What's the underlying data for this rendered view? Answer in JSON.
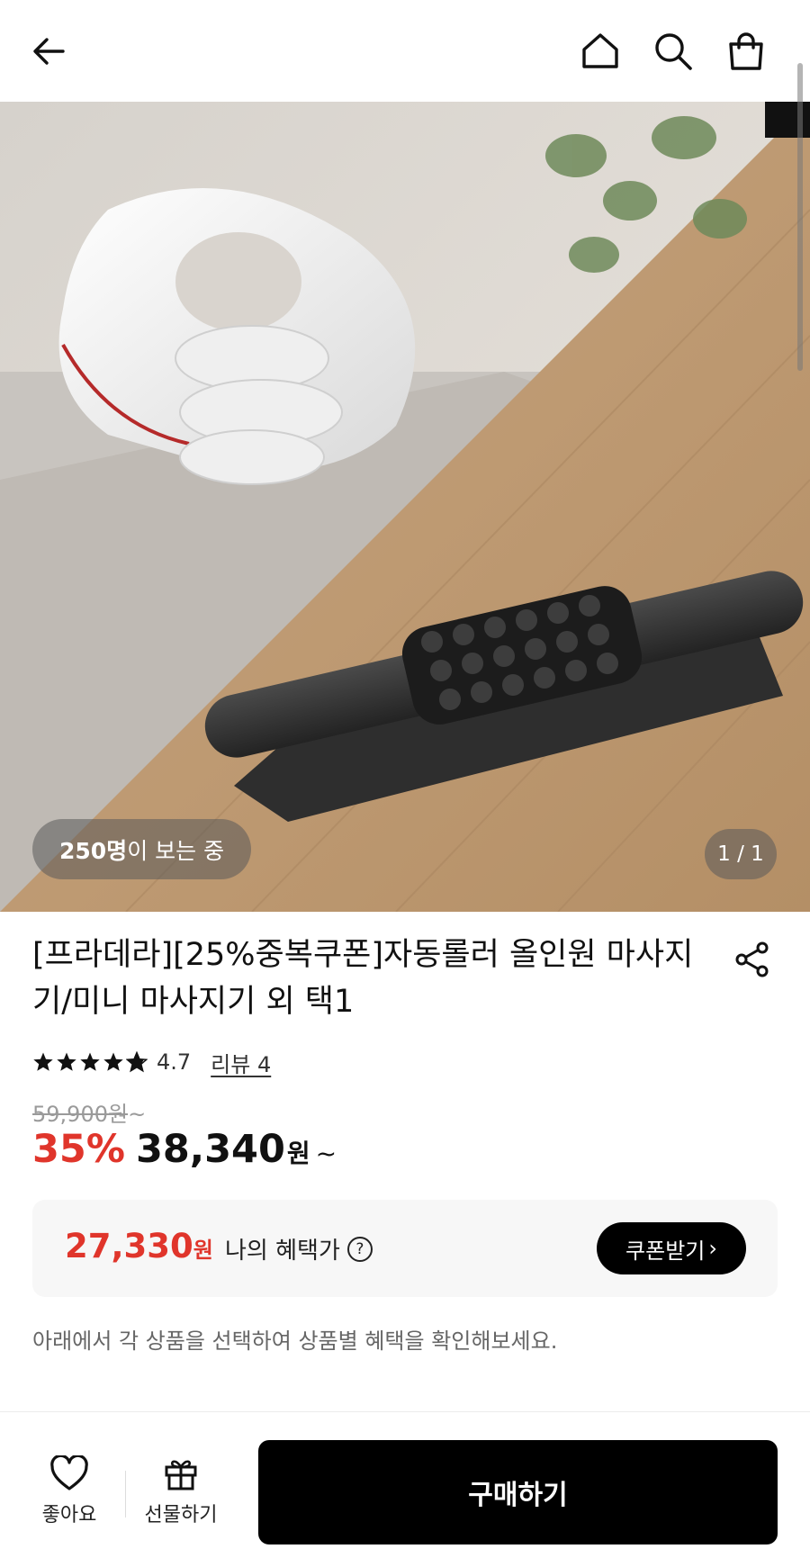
{
  "header": {
    "back_icon": "arrow-left-icon",
    "home_icon": "home-icon",
    "search_icon": "search-icon",
    "cart_icon": "shopping-bag-icon"
  },
  "hero": {
    "viewers_count": "250명",
    "viewers_suffix": "이 보는 중",
    "pager": "1 / 1"
  },
  "product": {
    "title": "[프라데라][25%중복쿠폰]자동롤러 올인원 마사지기/미니 마사지기 외 택1",
    "rating": {
      "stars": 4.7,
      "value": "4.7",
      "review_label": "리뷰 4"
    },
    "original_price": "59,900원",
    "original_price_suffix": "~",
    "discount": "35%",
    "price": "38,340",
    "price_unit": "원",
    "price_suffix": "~"
  },
  "benefit": {
    "price": "27,330",
    "price_unit": "원",
    "label": "나의 혜택가",
    "help_glyph": "?",
    "coupon_button": "쿠폰받기",
    "coupon_chevron": "›"
  },
  "notice": "아래에서 각 상품을 선택하여 상품별 혜택을 확인해보세요.",
  "bottom_bar": {
    "like_label": "좋아요",
    "gift_label": "선물하기",
    "buy_label": "구매하기"
  },
  "colors": {
    "accent_red": "#e0352b",
    "button_black": "#000000",
    "benefit_bg": "#f7f7f7"
  }
}
